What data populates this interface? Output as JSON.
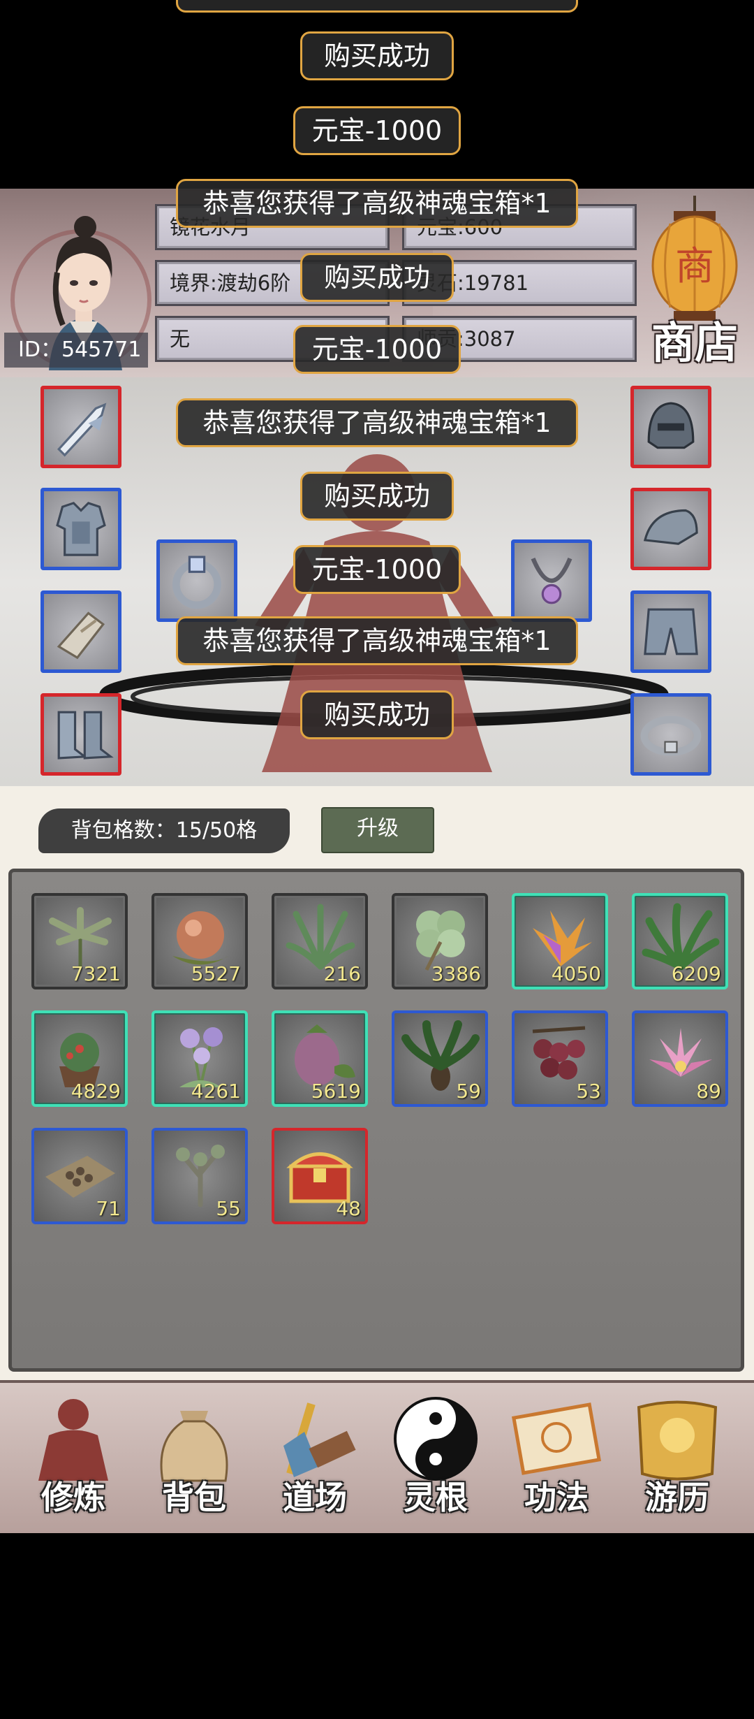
{
  "player": {
    "id_label": "ID：545771",
    "name": "镜花水月",
    "realm": "境界:渡劫6阶",
    "sect": "无",
    "yuanbao": "元宝:600",
    "lingshi": "灵石:19781",
    "gongxian": "师贡:3087"
  },
  "shop": {
    "label": "商店",
    "icon": "lantern-icon"
  },
  "bag": {
    "count_label": "背包格数：15/50格",
    "upgrade_label": "升级",
    "items": [
      {
        "icon": "palm-herb-icon",
        "qty": "7321",
        "rarity": "common"
      },
      {
        "icon": "spirit-peach-icon",
        "qty": "5527",
        "rarity": "common"
      },
      {
        "icon": "grass-herb-icon",
        "qty": "216",
        "rarity": "common"
      },
      {
        "icon": "clover-herb-icon",
        "qty": "3386",
        "rarity": "common"
      },
      {
        "icon": "flame-flower-icon",
        "qty": "4050",
        "rarity": "green"
      },
      {
        "icon": "leaf-herb-icon",
        "qty": "6209",
        "rarity": "green"
      },
      {
        "icon": "potted-succulent-icon",
        "qty": "4829",
        "rarity": "green"
      },
      {
        "icon": "purple-flower-icon",
        "qty": "4261",
        "rarity": "green"
      },
      {
        "icon": "spirit-fruit-icon",
        "qty": "5619",
        "rarity": "green"
      },
      {
        "icon": "fern-herb-icon",
        "qty": "59",
        "rarity": "blue"
      },
      {
        "icon": "berry-cluster-icon",
        "qty": "53",
        "rarity": "blue"
      },
      {
        "icon": "lotus-flower-icon",
        "qty": "89",
        "rarity": "blue"
      },
      {
        "icon": "seed-pile-icon",
        "qty": "71",
        "rarity": "blue"
      },
      {
        "icon": "sapling-icon",
        "qty": "55",
        "rarity": "blue"
      },
      {
        "icon": "treasure-chest-icon",
        "qty": "48",
        "rarity": "red"
      }
    ]
  },
  "equipment": {
    "slots": [
      {
        "name": "weapon-slot",
        "icon": "sword-icon",
        "rarity": "red"
      },
      {
        "name": "armor-slot",
        "icon": "chest-armor-icon",
        "rarity": "blue"
      },
      {
        "name": "bracer-slot",
        "icon": "bracer-icon",
        "rarity": "blue"
      },
      {
        "name": "boots-slot",
        "icon": "boots-icon",
        "rarity": "red"
      },
      {
        "name": "ring-slot",
        "icon": "ring-icon",
        "rarity": "blue"
      },
      {
        "name": "necklace-slot",
        "icon": "necklace-icon",
        "rarity": "blue"
      },
      {
        "name": "helmet-slot",
        "icon": "helmet-icon",
        "rarity": "red"
      },
      {
        "name": "shoulder-slot",
        "icon": "shoulder-icon",
        "rarity": "red"
      },
      {
        "name": "pants-slot",
        "icon": "pants-icon",
        "rarity": "blue"
      },
      {
        "name": "belt-slot",
        "icon": "belt-icon",
        "rarity": "blue"
      }
    ]
  },
  "nav": [
    {
      "label": "修炼",
      "icon": "cultivate-icon"
    },
    {
      "label": "背包",
      "icon": "bag-icon"
    },
    {
      "label": "道场",
      "icon": "dojo-icon"
    },
    {
      "label": "灵根",
      "icon": "yin-yang-icon"
    },
    {
      "label": "功法",
      "icon": "scroll-icon"
    },
    {
      "label": "游历",
      "icon": "map-icon"
    }
  ],
  "toasts": {
    "chest": "恭喜您获得了高级神魂宝箱*1",
    "buy": "购买成功",
    "yuanbao": "元宝-1000"
  },
  "colors": {
    "blue_rarity": "#2d59d2",
    "red_rarity": "#d5262b",
    "green_rarity": "#3fe0b6",
    "toast_border": "#e0a542",
    "qty_text": "#f3e88f"
  }
}
